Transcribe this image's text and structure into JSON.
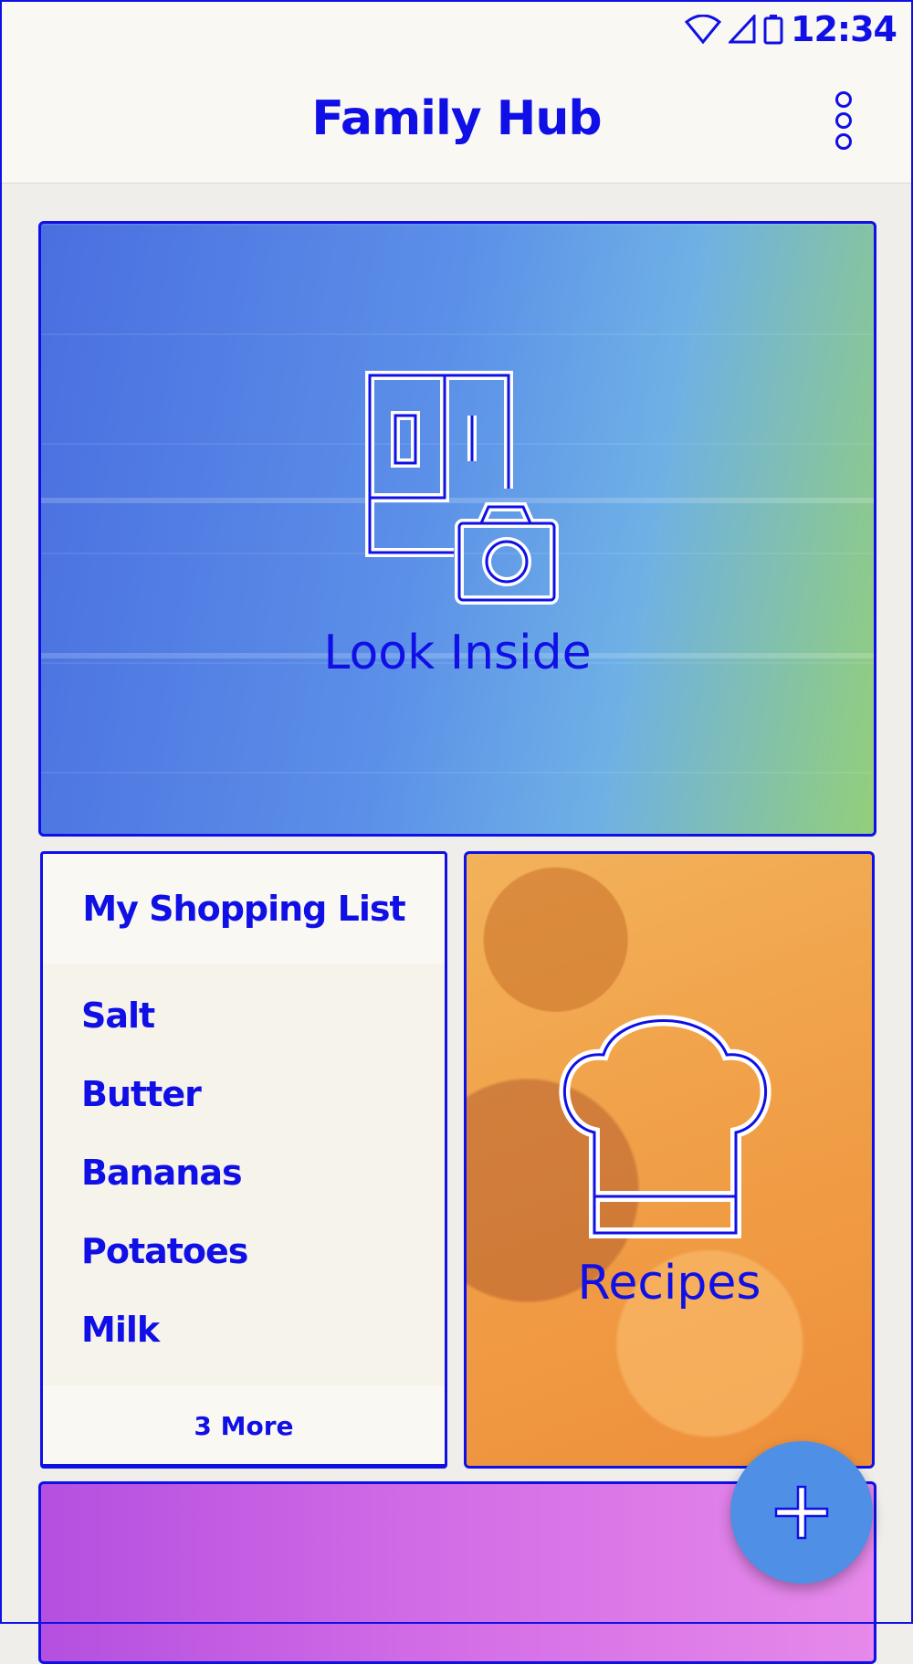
{
  "status_bar": {
    "time": "12:34",
    "icons": [
      "wifi-icon",
      "signal-icon",
      "battery-icon"
    ]
  },
  "app_bar": {
    "title": "Family Hub",
    "menu_icon": "more-vert-icon"
  },
  "look_inside": {
    "label": "Look Inside",
    "icon": "fridge-camera-icon"
  },
  "shopping_list": {
    "title": "My Shopping List",
    "items": [
      "Salt",
      "Butter",
      "Bananas",
      "Potatoes",
      "Milk"
    ],
    "more_label": "3 More"
  },
  "recipes": {
    "label": "Recipes",
    "icon": "chef-hat-icon"
  },
  "fab": {
    "icon": "plus-icon"
  },
  "colors": {
    "accent": "#1010e6",
    "fab": "#4f8fe6",
    "background": "#efeeeb",
    "appbar": "#faf8f3"
  }
}
